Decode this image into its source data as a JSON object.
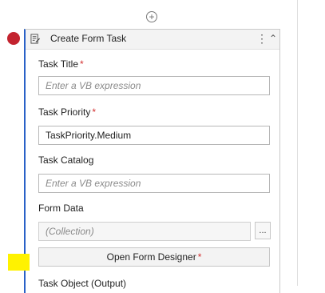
{
  "activity": {
    "title": "Create Form Task",
    "icons": {
      "add": "plus-circle-icon",
      "activity": "form-task-icon",
      "menu": "kebab-icon",
      "collapse": "chevron-up-double-icon",
      "breakpoint": "breakpoint-icon"
    },
    "fields": {
      "task_title": {
        "label": "Task Title",
        "required": "*",
        "value": "",
        "placeholder": "Enter a VB expression"
      },
      "task_priority": {
        "label": "Task Priority",
        "required": "*",
        "value": "TaskPriority.Medium"
      },
      "task_catalog": {
        "label": "Task Catalog",
        "value": "",
        "placeholder": "Enter a VB expression"
      },
      "form_data": {
        "label": "Form Data",
        "value": "",
        "placeholder": "(Collection)"
      },
      "task_object": {
        "label": "Task Object (Output)"
      }
    },
    "buttons": {
      "ellipsis": "...",
      "open_form_designer": "Open Form Designer",
      "open_form_designer_required": "*"
    }
  },
  "colors": {
    "accent_border": "#2a61c7",
    "breakpoint": "#c3232f",
    "required": "#d32f2f",
    "highlight": "#fff200"
  }
}
